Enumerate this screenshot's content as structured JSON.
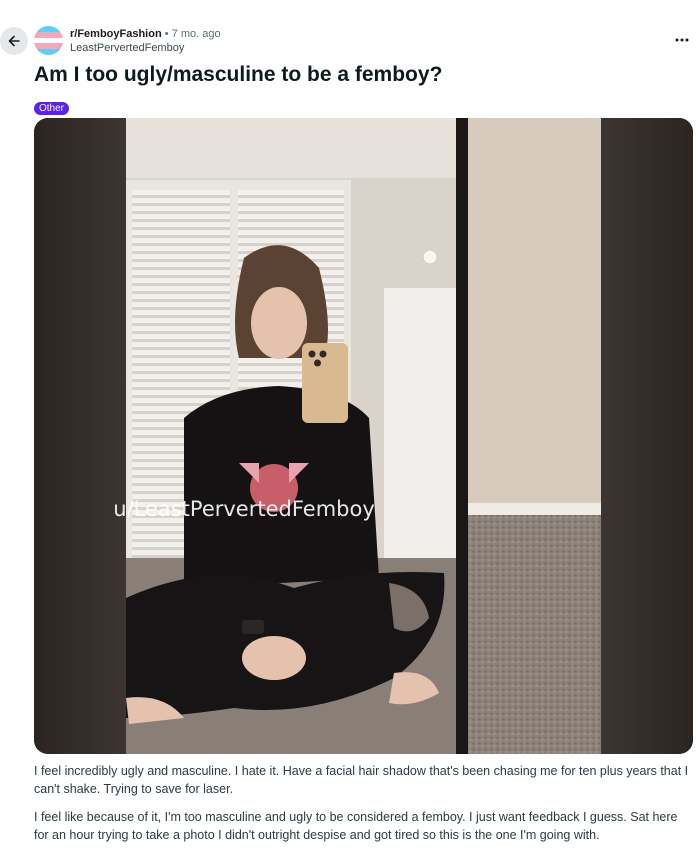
{
  "post": {
    "subreddit": "r/FemboyFashion",
    "separator": "•",
    "time_ago": "7 mo. ago",
    "author": "LeastPervertedFemboy",
    "title": "Am I too ugly/masculine to be a femboy?",
    "flair": "Other",
    "image_watermark": "u/LeastPervertedFemboy",
    "body": [
      "I feel incredibly ugly and masculine. I hate it. Have a facial hair shadow that's been chasing me for ten plus years that I can't shake. Trying to save for laser.",
      "I feel like because of it, I'm too masculine and ugly to be considered a femboy. I just want feedback I guess. Sat here for an hour trying to take a photo I didn't outright despise and got tired so this is the one I'm going with."
    ]
  },
  "icons": {
    "back": "arrow-left-icon",
    "more": "more-horizontal-icon",
    "avatar": "trans-flag-avatar"
  },
  "colors": {
    "flair_bg": "#5a21f3",
    "back_bg": "#e4e8ea",
    "flag_blue": "#5bcefa",
    "flag_pink": "#f5a9b8"
  }
}
